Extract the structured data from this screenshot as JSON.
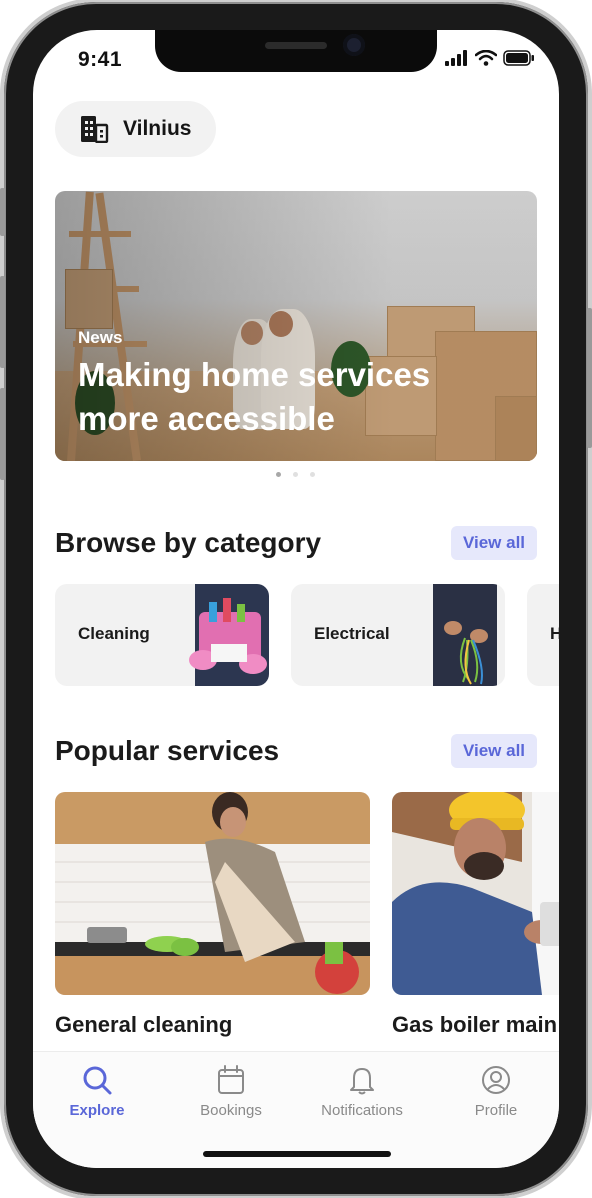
{
  "status_bar": {
    "time": "9:41"
  },
  "location": {
    "icon": "building-icon",
    "label": "Vilnius"
  },
  "hero": {
    "tag": "News",
    "title": "Making home services more accessible",
    "carousel_pages": 3,
    "active_page": 1
  },
  "categories": {
    "title": "Browse by category",
    "view_all_label": "View all",
    "items": [
      {
        "label": "Cleaning"
      },
      {
        "label": "Electrical"
      },
      {
        "label": "H"
      }
    ]
  },
  "popular": {
    "title": "Popular services",
    "view_all_label": "View all",
    "items": [
      {
        "title": "General cleaning"
      },
      {
        "title": "Gas boiler main"
      }
    ]
  },
  "tabbar": {
    "items": [
      {
        "label": "Explore",
        "icon": "search-icon",
        "active": true
      },
      {
        "label": "Bookings",
        "icon": "calendar-icon",
        "active": false
      },
      {
        "label": "Notifications",
        "icon": "bell-icon",
        "active": false
      },
      {
        "label": "Profile",
        "icon": "profile-icon",
        "active": false
      }
    ]
  },
  "colors": {
    "accent": "#5a67d8",
    "accent_bg": "#e6e8fb",
    "card_bg": "#f2f2f2"
  }
}
